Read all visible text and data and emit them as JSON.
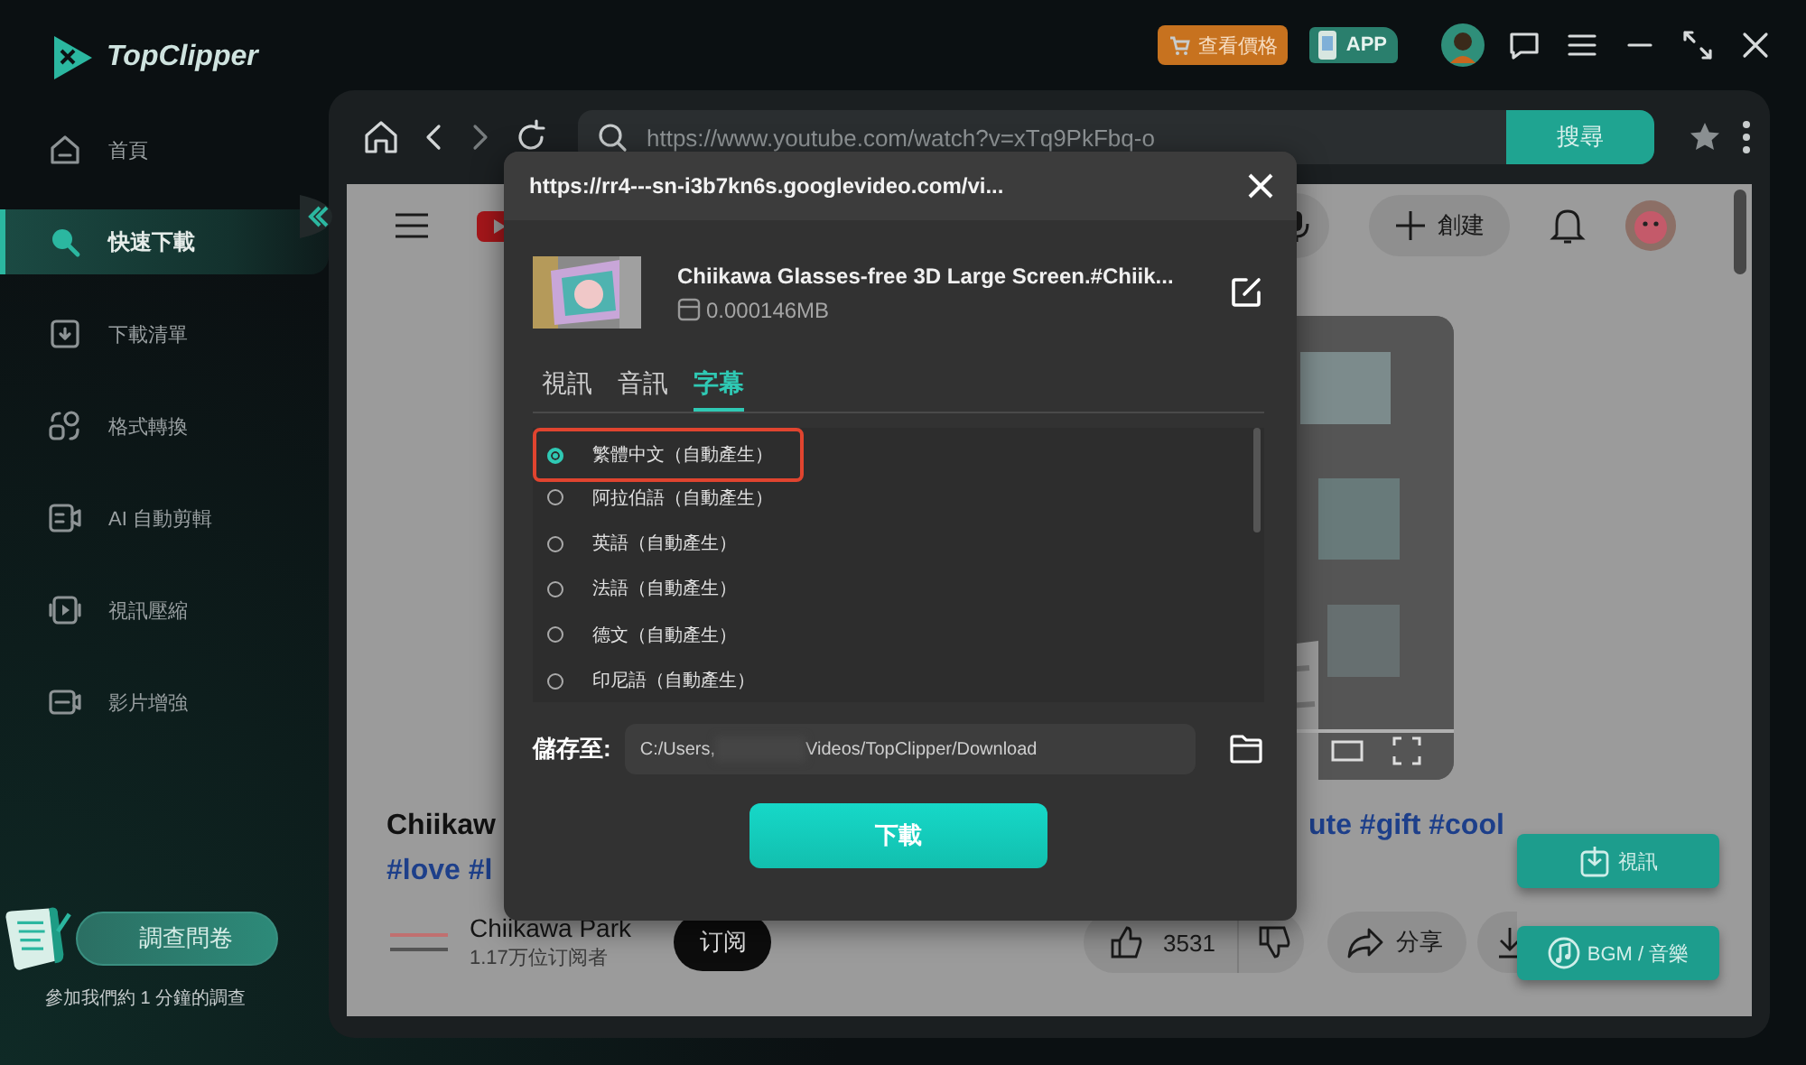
{
  "app": {
    "logo_text": "TopClipper"
  },
  "top_bar": {
    "price_button": "查看價格",
    "app_badge": "APP"
  },
  "sidebar": {
    "items": [
      {
        "label": "首頁",
        "selected": false
      },
      {
        "label": "快速下載",
        "selected": true
      },
      {
        "label": "下載清單",
        "selected": false
      },
      {
        "label": "格式轉換",
        "selected": false
      },
      {
        "label": "AI 自動剪輯",
        "selected": false
      },
      {
        "label": "視訊壓縮",
        "selected": false
      },
      {
        "label": "影片增強",
        "selected": false
      }
    ],
    "survey": {
      "button": "調查問卷",
      "caption": "參加我們約 1 分鐘的調查"
    }
  },
  "browser": {
    "url": "https://www.youtube.com/watch?v=xTq9PkFbq-o",
    "search_button": "搜尋"
  },
  "web_page": {
    "create_button": "創建",
    "title_left": "Chiikaw",
    "title_right": "ute #gift #cool",
    "tags_left": "#love #l",
    "channel_name": "Chiikawa Park",
    "subscribers": "1.17万位订阅者",
    "subscribe_button": "订阅",
    "likes": "3531",
    "share_button": "分享"
  },
  "dialog": {
    "title": "https://rr4---sn-i3b7kn6s.googlevideo.com/vi...",
    "video_title": "Chiikawa Glasses-free 3D Large Screen.#Chiik...",
    "file_size": "0.000146MB",
    "tabs": [
      {
        "label": "視訊",
        "selected": false
      },
      {
        "label": "音訊",
        "selected": false
      },
      {
        "label": "字幕",
        "selected": true
      }
    ],
    "options": [
      {
        "label": "繁體中文（自動產生）",
        "selected": true,
        "highlighted": true
      },
      {
        "label": "阿拉伯語（自動產生）",
        "selected": false,
        "highlighted": false
      },
      {
        "label": "英語（自動產生）",
        "selected": false,
        "highlighted": false
      },
      {
        "label": "法語（自動產生）",
        "selected": false,
        "highlighted": false
      },
      {
        "label": "德文（自動產生）",
        "selected": false,
        "highlighted": false
      },
      {
        "label": "印尼語（自動產生）",
        "selected": false,
        "highlighted": false
      }
    ],
    "save_label": "儲存至:",
    "path_parts": [
      "C:/Users,",
      "Videos/TopClipper/Download"
    ],
    "download_button": "下載"
  },
  "floating_buttons": [
    {
      "label": "視訊"
    },
    {
      "label": "BGM / 音樂"
    }
  ]
}
